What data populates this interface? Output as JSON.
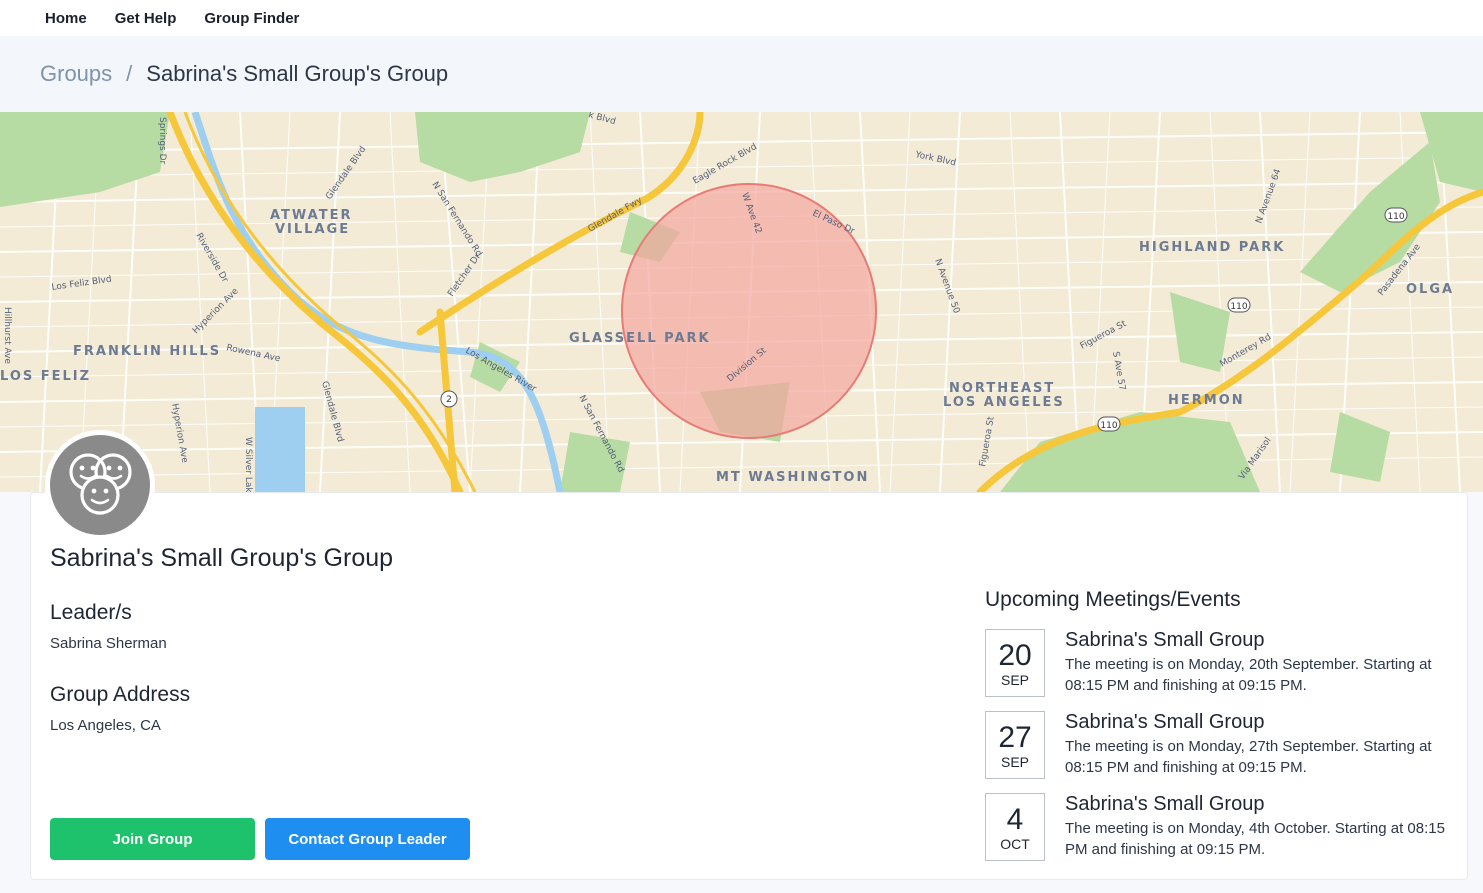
{
  "nav": {
    "items": [
      {
        "label": "Home"
      },
      {
        "label": "Get Help"
      },
      {
        "label": "Group Finder"
      }
    ]
  },
  "breadcrumb": {
    "parent": "Groups",
    "separator": "/",
    "current": "Sabrina's Small Group's Group"
  },
  "map": {
    "neighborhoods": [
      "ATWATER",
      "VILLAGE",
      "FRANKLIN HILLS",
      "LOS FELIZ",
      "GLASSELL PARK",
      "MT WASHINGTON",
      "HIGHLAND PARK",
      "NORTHEAST",
      "LOS ANGELES",
      "HERMON",
      "OLGA"
    ],
    "streets": [
      "Glendale Fwy",
      "Eagle Rock Blvd",
      "York Blvd",
      "Los Feliz Blvd",
      "Riverside Dr",
      "Hyperion Ave",
      "Rowena Ave",
      "Glendale Blvd",
      "N San Fernando Rd",
      "Fletcher Dr",
      "Los Angeles River",
      "W Ave 42",
      "El Paso Dr",
      "Division St",
      "N Avenue 50",
      "Figueroa St",
      "S Ave 57",
      "Monterey Rd",
      "Pasadena Ave",
      "N Avenue 64",
      "Via Marisol",
      "W Silver Lake",
      "Hillhurst Ave",
      "Springs Dr",
      "Glendale Blvd",
      "Hyperion Ave",
      "Figueroa St",
      "k Blvd",
      "N San Fernando Rd"
    ],
    "highway_shields": [
      "110",
      "110",
      "110",
      "2"
    ],
    "colors": {
      "land": "#f3ebd6",
      "park": "#b6dba3",
      "water": "#9ecff0",
      "highway": "#f6c73a",
      "radius_fill": "#f4a7a0",
      "radius_stroke": "#e87b75"
    }
  },
  "group": {
    "title": "Sabrina's Small Group's Group",
    "avatar_icon": "group-faces-icon",
    "leaders_heading": "Leader/s",
    "leaders_value": "Sabrina Sherman",
    "address_heading": "Group Address",
    "address_value": "Los Angeles, CA"
  },
  "actions": {
    "join": "Join Group",
    "contact": "Contact Group Leader"
  },
  "events": {
    "heading": "Upcoming Meetings/Events",
    "items": [
      {
        "day": "20",
        "month": "SEP",
        "title": "Sabrina's Small Group",
        "desc": "The meeting is on Monday, 20th September. Starting at 08:15 PM and finishing at 09:15 PM."
      },
      {
        "day": "27",
        "month": "SEP",
        "title": "Sabrina's Small Group",
        "desc": "The meeting is on Monday, 27th September. Starting at 08:15 PM and finishing at 09:15 PM."
      },
      {
        "day": "4",
        "month": "OCT",
        "title": "Sabrina's Small Group",
        "desc": "The meeting is on Monday, 4th October. Starting at 08:15 PM and finishing at 09:15 PM."
      }
    ]
  }
}
